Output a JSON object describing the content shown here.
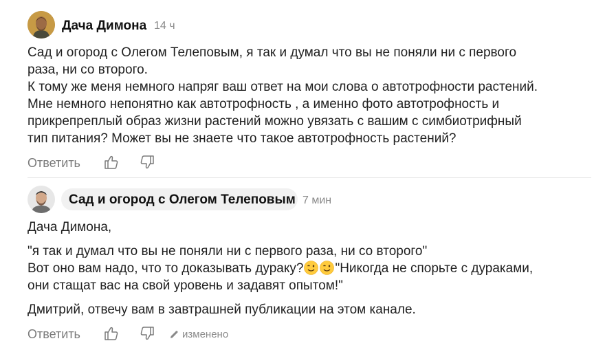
{
  "comments": [
    {
      "author": "Дача Димона",
      "time": "14 ч",
      "lines": [
        "Сад и огород с Олегом Телеповым, я так и думал что вы не поняли ни с первого",
        "раза, ни со второго.",
        "К тому же меня немного напряг ваш ответ на мои слова о автотрофности растений.",
        "Мне немного непонятно как автотрофность , а именно фото автотрофность и",
        "прикрепреплый образ жизни растений можно увязать с вашим с симбиотрифный",
        "тип питания? Может вы не знаете что такое автотрофность растений?"
      ],
      "reply_label": "Ответить",
      "like_icon": "thumb-up-icon",
      "dislike_icon": "thumb-down-icon"
    },
    {
      "author": "Сад и огород с Олегом Телеповым",
      "time": "7 мин",
      "greeting": "Дача Димона,",
      "quote": "\"я так и думал что вы не поняли ни с первого раза, ни со второго\"",
      "line2_before": "Вот оно вам надо, что то доказывать дураку?",
      "line2_after": "\"Никогда не спорьте с дураками,",
      "line3": "они стащат вас на свой уровень и задавят опытом!\"",
      "closing": "Дмитрий, отвечу вам в завтрашней публикации на этом канале.",
      "emoji_icon": "winking-face-icon",
      "reply_label": "Ответить",
      "edited_label": "изменено",
      "like_icon": "thumb-up-icon",
      "dislike_icon": "thumb-down-icon"
    }
  ]
}
